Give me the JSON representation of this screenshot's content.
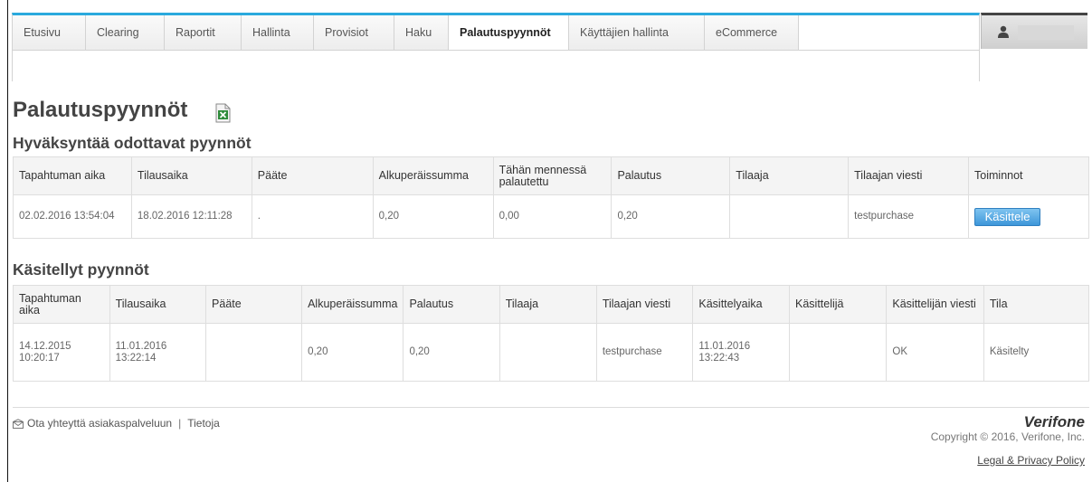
{
  "nav": {
    "tabs": [
      "Etusivu",
      "Clearing",
      "Raportit",
      "Hallinta",
      "Provisiot",
      "Haku",
      "Palautuspyynnöt",
      "Käyttäjien hallinta",
      "eCommerce"
    ],
    "active_tab": "Palautuspyynnöt"
  },
  "page": {
    "title": "Palautuspyynnöt",
    "export_icon": "excel-icon"
  },
  "pending": {
    "title": "Hyväksyntää odottavat pyynnöt",
    "headers": [
      "Tapahtuman aika",
      "Tilausaika",
      "Pääte",
      "Alkuperäissumma",
      "Tähän mennessä palautettu",
      "Palautus",
      "Tilaaja",
      "Tilaajan viesti",
      "Toiminnot"
    ],
    "rows": [
      {
        "tapahtuman_aika": "02.02.2016 13:54:04",
        "tilausaika": "18.02.2016 12:11:28",
        "paate": ".",
        "alkuperaissumma": "0,20",
        "palautettu": "0,00",
        "palautus": "0,20",
        "tilaaja": "",
        "viesti": "testpurchase",
        "action_label": "Käsittele"
      }
    ]
  },
  "processed": {
    "title": "Käsitellyt pyynnöt",
    "headers": [
      "Tapahtuman aika",
      "Tilausaika",
      "Pääte",
      "Alkuperäissumma",
      "Palautus",
      "Tilaaja",
      "Tilaajan viesti",
      "Käsittelyaika",
      "Käsittelijä",
      "Käsittelijän viesti",
      "Tila"
    ],
    "rows": [
      {
        "tapahtuman_aika": "14.12.2015 10:20:17",
        "tilausaika": "11.01.2016 13:22:14",
        "paate": "",
        "alkuperaissumma": "0,20",
        "palautus": "0,20",
        "tilaaja": "",
        "viesti": "testpurchase",
        "kasittelyaika": "11.01.2016 13:22:43",
        "kasittelija": "",
        "kasittelijan_viesti": "OK",
        "tila": "Käsitelty"
      }
    ]
  },
  "footer": {
    "contact": "Ota yhteyttä asiakaspalveluun",
    "separator": "|",
    "info": "Tietoja",
    "brand": "Verifone",
    "copyright": "Copyright © 2016, Verifone, Inc.",
    "legal": "Legal & Privacy Policy"
  },
  "colors": {
    "accent": "#2aa9dd",
    "button": "#3d96d9"
  }
}
